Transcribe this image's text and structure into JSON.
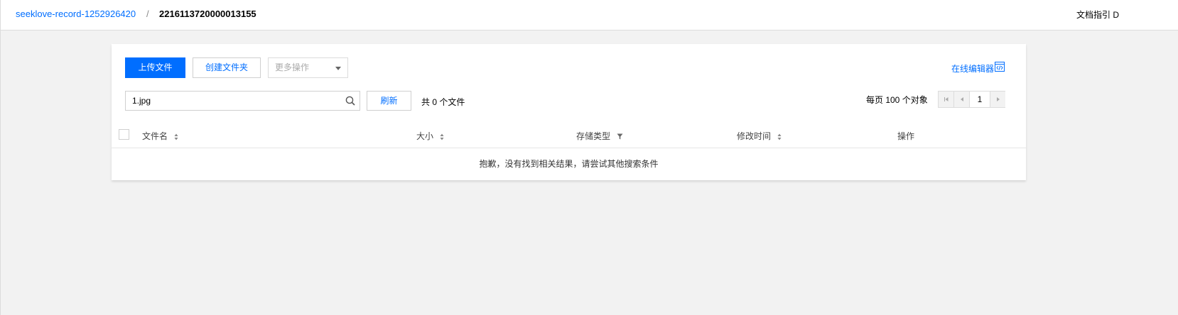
{
  "breadcrumb": {
    "bucket": "seeklove-record-1252926420",
    "separator": "/",
    "folder": "2216113720000013155"
  },
  "header": {
    "doc_link": "文档指引 D"
  },
  "toolbar": {
    "upload_label": "上传文件",
    "create_folder_label": "创建文件夹",
    "more_actions_placeholder": "更多操作",
    "online_editor_label": "在线编辑器"
  },
  "search": {
    "value": "1.jpg"
  },
  "refresh_label": "刷新",
  "file_count": "共 0 个文件",
  "pagination": {
    "per_page_label": "每页 100 个对象",
    "current_page": "1"
  },
  "table": {
    "columns": [
      "文件名",
      "大小",
      "存储类型",
      "修改时间",
      "操作"
    ],
    "empty_message": "抱歉，没有找到相关结果，请尝试其他搜索条件"
  },
  "colors": {
    "accent": "#006eff",
    "background": "#f2f2f2"
  },
  "icons": [
    "search-icon",
    "editor-code-icon",
    "sort-icon",
    "filter-icon",
    "first-page-icon",
    "prev-page-icon",
    "next-page-icon"
  ]
}
